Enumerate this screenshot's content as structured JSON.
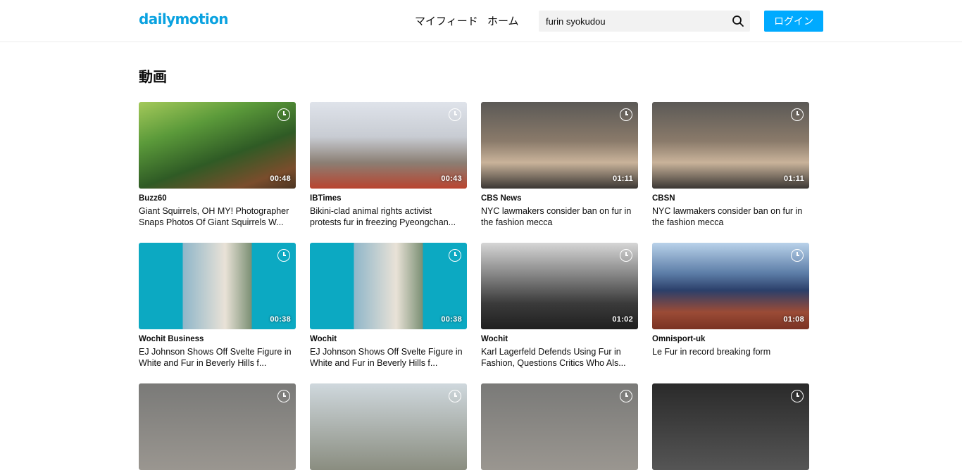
{
  "header": {
    "logo": "dailymotion",
    "nav": [
      "マイフィード",
      "ホーム"
    ],
    "search_value": "furin syokudou",
    "login_label": "ログイン"
  },
  "section_title": "動画",
  "videos": [
    {
      "channel": "Buzz60",
      "title_line1": "Giant Squirrels, OH MY! Photographer",
      "title_line2": "Snaps Photos Of Giant Squirrels W...",
      "duration": "00:48"
    },
    {
      "channel": "IBTimes",
      "title_line1": "Bikini-clad animal rights activist",
      "title_line2": "protests fur in freezing Pyeongchan...",
      "duration": "00:43"
    },
    {
      "channel": "CBS News",
      "title_line1": "NYC lawmakers consider ban on fur in",
      "title_line2": "the fashion mecca",
      "duration": "01:11"
    },
    {
      "channel": "CBSN",
      "title_line1": "NYC lawmakers consider ban on fur in",
      "title_line2": "the fashion mecca",
      "duration": "01:11"
    },
    {
      "channel": "Wochit Business",
      "title_line1": "EJ Johnson Shows Off Svelte Figure in",
      "title_line2": "White and Fur in Beverly Hills f...",
      "duration": "00:38"
    },
    {
      "channel": "Wochit",
      "title_line1": "EJ Johnson Shows Off Svelte Figure in",
      "title_line2": "White and Fur in Beverly Hills f...",
      "duration": "00:38"
    },
    {
      "channel": "Wochit",
      "title_line1": "Karl Lagerfeld Defends Using Fur in",
      "title_line2": "Fashion, Questions Critics Who Als...",
      "duration": "01:02"
    },
    {
      "channel": "Omnisport-uk",
      "title_line1": "Le Fur in record breaking form",
      "title_line2": "",
      "duration": "01:08"
    },
    {
      "channel": "",
      "title_line1": "",
      "title_line2": "",
      "duration": ""
    },
    {
      "channel": "",
      "title_line1": "",
      "title_line2": "",
      "duration": ""
    },
    {
      "channel": "",
      "title_line1": "",
      "title_line2": "",
      "duration": ""
    },
    {
      "channel": "",
      "title_line1": "",
      "title_line2": "",
      "duration": ""
    }
  ],
  "icons": {
    "search": "search-icon",
    "watch_later": "clock-icon"
  },
  "colors": {
    "brand": "#0aa2e0",
    "login_button": "#00aaff"
  }
}
